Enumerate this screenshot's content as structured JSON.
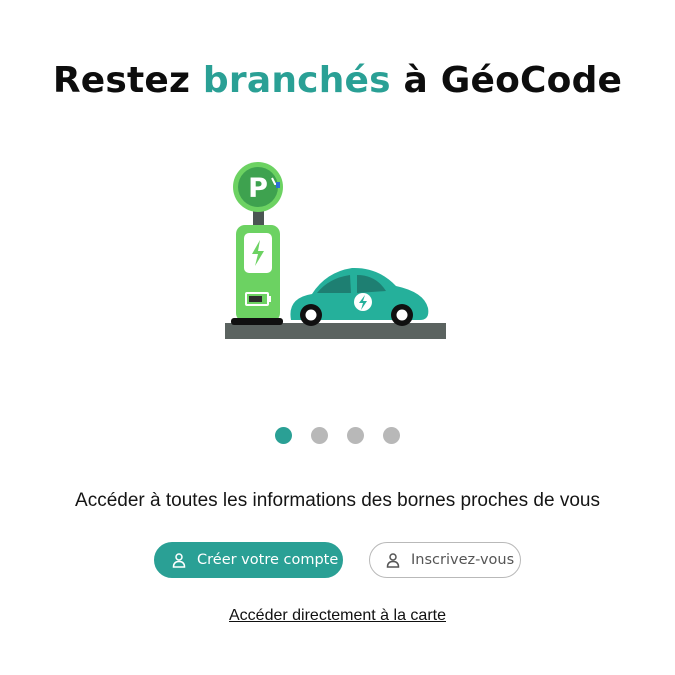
{
  "header": {
    "title_before": "Restez",
    "title_accent": "branchés",
    "title_after": "à GéoCode"
  },
  "illustration": {
    "charger_sign_letter": "P",
    "icons": [
      "charging-station-icon",
      "electric-car-icon",
      "lightning-icon",
      "battery-icon"
    ]
  },
  "carousel": {
    "total_slides": 4,
    "active_index": 0
  },
  "main": {
    "subtitle": "Accéder à toutes les informations des bornes proches de vous"
  },
  "actions": {
    "create_account_label": "Créer votre compte",
    "signup_label": "Inscrivez-vous",
    "map_link_label": "Accéder directement à la carte"
  },
  "colors": {
    "accent": "#2aa095",
    "inactive_dot": "#b8b8b8",
    "charger_green": "#6cd262",
    "car_teal": "#25b09b",
    "ground": "#5b6360"
  }
}
